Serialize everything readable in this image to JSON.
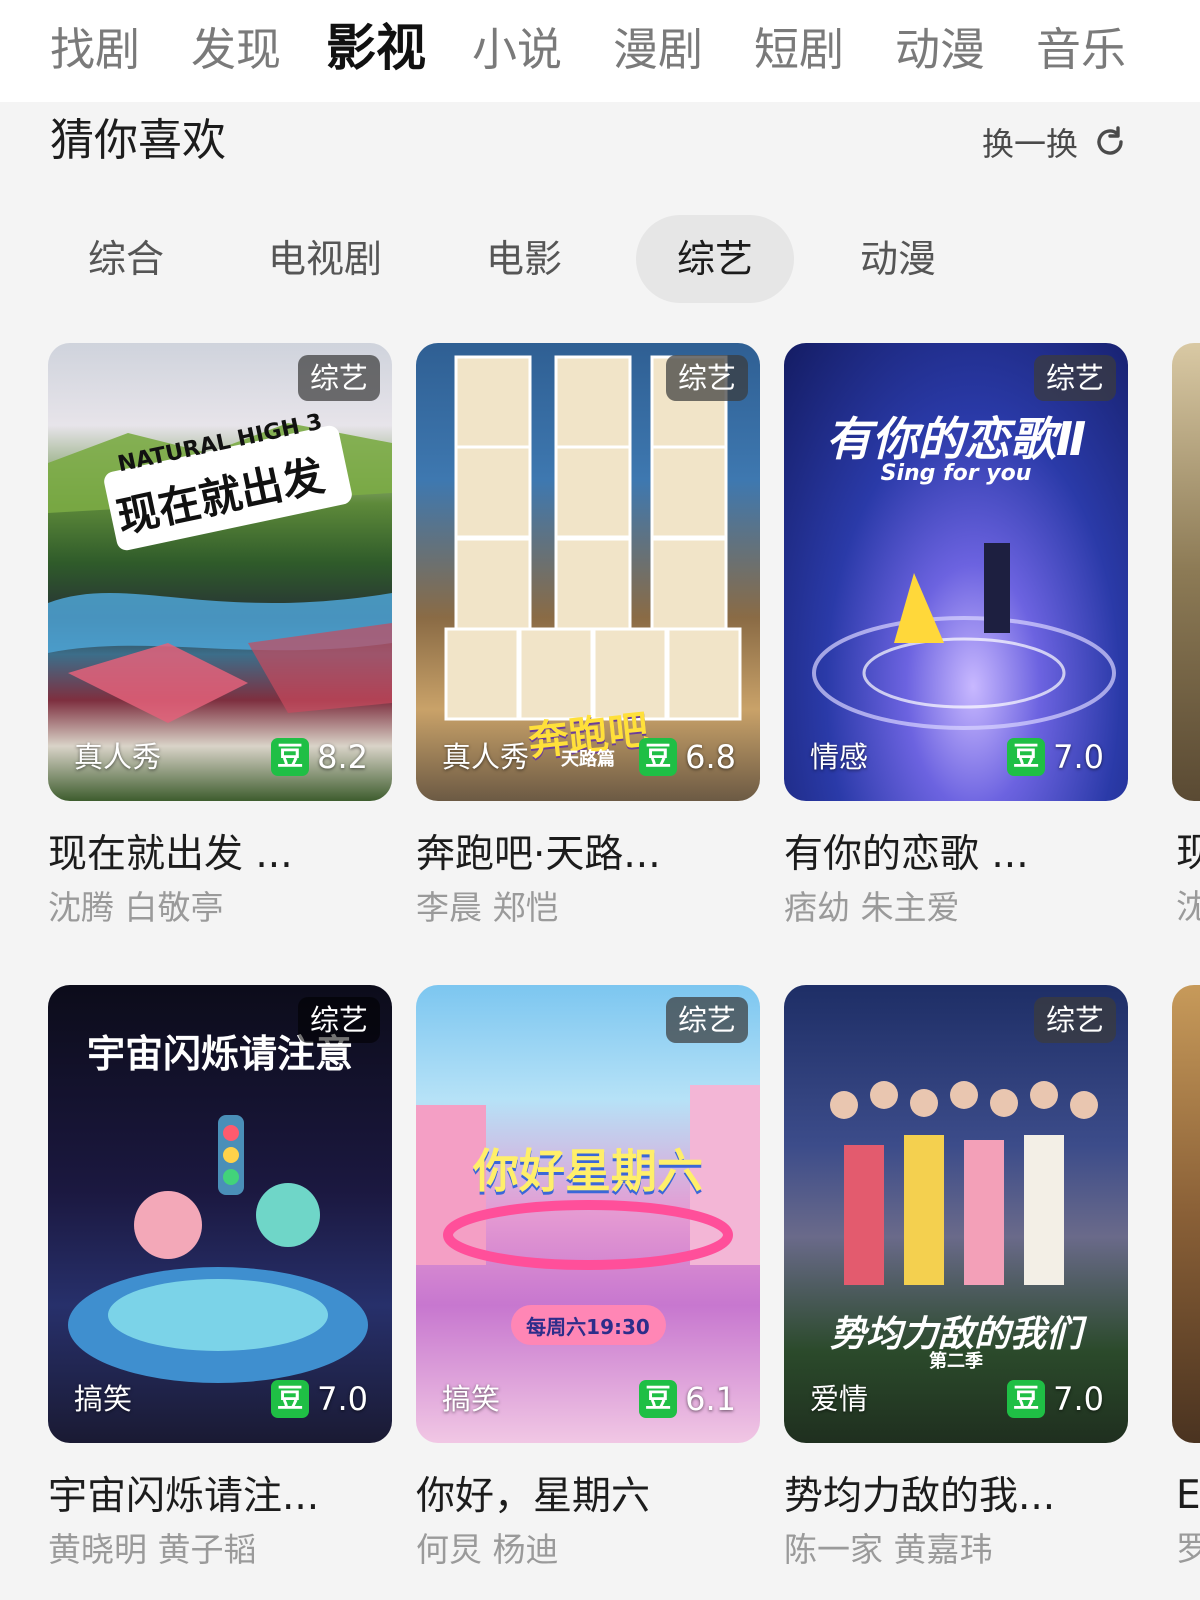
{
  "top_nav": {
    "tabs": [
      "找剧",
      "发现",
      "影视",
      "小说",
      "漫剧",
      "短剧",
      "动漫",
      "音乐"
    ],
    "active": "影视"
  },
  "section": {
    "title": "猜你喜欢",
    "refresh_label": "换一换",
    "refresh_icon": "refresh-icon"
  },
  "categories": {
    "items": [
      "综合",
      "电视剧",
      "电影",
      "综艺",
      "动漫"
    ],
    "active": "综艺"
  },
  "cards": [
    {
      "tag": "综艺",
      "genre": "真人秀",
      "score": "8.2",
      "title": "现在就出发 ...",
      "cast": "沈腾 白敬亭",
      "poster_text": "现在就出发",
      "poster_sub": "NATURAL HIGH 3"
    },
    {
      "tag": "综艺",
      "genre": "真人秀",
      "score": "6.8",
      "title": "奔跑吧·天路...",
      "cast": "李晨 郑恺",
      "poster_text": "奔跑吧",
      "poster_sub": "天路篇"
    },
    {
      "tag": "综艺",
      "genre": "情感",
      "score": "7.0",
      "title": "有你的恋歌 ...",
      "cast": "痞幼 朱主爱",
      "poster_text": "有你的恋歌Ⅱ",
      "poster_sub": "Sing for you"
    },
    {
      "tag": "综艺",
      "genre": "搞笑",
      "score": "7.0",
      "title": "宇宙闪烁请注...",
      "cast": "黄晓明 黄子韬",
      "poster_text": "宇宙闪烁请注意",
      "poster_sub": ""
    },
    {
      "tag": "综艺",
      "genre": "搞笑",
      "score": "6.1",
      "title": "你好，星期六",
      "cast": "何炅 杨迪",
      "poster_text": "你好星期六",
      "poster_sub": "每周六19:30"
    },
    {
      "tag": "综艺",
      "genre": "爱情",
      "score": "7.0",
      "title": "势均力敌的我...",
      "cast": "陈一家 黄嘉玮",
      "poster_text": "势均力敌的我们",
      "poster_sub": "第二季"
    }
  ],
  "peek": {
    "row1_title": "现",
    "row1_cast": "沈",
    "row2_title": "E",
    "row2_cast": "罗"
  },
  "colors": {
    "douban_green": "#1fbf45",
    "active_chip_bg": "#e6e6e6",
    "page_bg": "#f4f4f4"
  }
}
